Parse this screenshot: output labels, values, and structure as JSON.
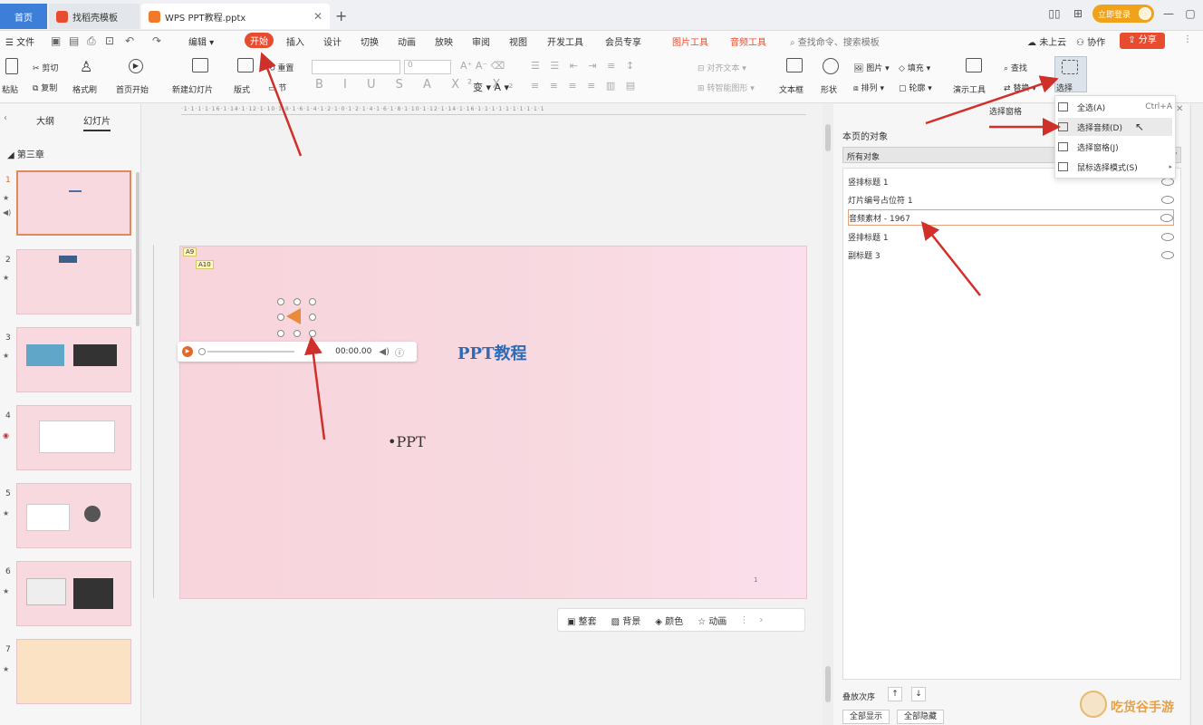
{
  "titlebar": {
    "home_tab": "首页",
    "template_tab": "找稻壳模板",
    "doc_tab": "WPS PPT教程.pptx",
    "login": "立即登录",
    "brand_color": "#3d7ed8",
    "accent": "#e84c2f"
  },
  "menu": {
    "file": "文件",
    "edit": "编辑",
    "start": "开始",
    "insert": "插入",
    "design": "设计",
    "transition": "切换",
    "animation": "动画",
    "slideshow": "放映",
    "review": "审阅",
    "view": "视图",
    "dev": "开发工具",
    "vip": "会员专享",
    "picture_tools": "图片工具",
    "audio_tools": "音频工具",
    "search": "查找命令、搜索模板",
    "cloud": "未上云",
    "collab": "协作",
    "share": "分享"
  },
  "ribbon": {
    "paste": "粘贴",
    "cut": "剪切",
    "copy": "复制",
    "format_painter": "格式刷",
    "from_start": "首页开始",
    "new_slide": "新建幻灯片",
    "layout": "版式",
    "section": "节",
    "reset": "重置",
    "font_size": "0",
    "align_text": "对齐文本",
    "smartart": "转智能图形",
    "textbox": "文本框",
    "shape": "形状",
    "picture": "图片",
    "arrange": "排列",
    "fill": "填充",
    "outline": "轮廓",
    "presentation_tool": "演示工具",
    "find": "查找",
    "replace": "替换",
    "select": "选择"
  },
  "left_panel": {
    "outline_tab": "大纲",
    "slides_tab": "幻灯片",
    "section_name": "第三章",
    "slides": [
      "1",
      "2",
      "3",
      "4",
      "5",
      "6",
      "7"
    ]
  },
  "slide": {
    "title": "PPT教程",
    "bullet": "•PPT",
    "tag1": "A9",
    "tag2": "A10",
    "audio_time": "00:00.00",
    "page_mark": "1"
  },
  "float_toolbar": {
    "theme": "整套",
    "background": "背景",
    "color": "颜色",
    "animation": "动画"
  },
  "right_panel": {
    "title": "选择窗格",
    "section": "本页的对象",
    "filter": "所有对象",
    "objects": [
      "竖排标题 1",
      "灯片编号占位符 1",
      "音频素材 - 1967",
      "竖排标题 1",
      "副标题 3"
    ],
    "order_label": "叠放次序",
    "show_all": "全部显示",
    "hide_all": "全部隐藏"
  },
  "dropdown": {
    "items": [
      {
        "label": "全选(A)",
        "shortcut": "Ctrl+A"
      },
      {
        "label": "选择音频(D)",
        "shortcut": ""
      },
      {
        "label": "选择窗格(J)",
        "shortcut": ""
      },
      {
        "label": "鼠标选择模式(S)",
        "shortcut": "▸"
      }
    ]
  },
  "watermark": "吃货谷手游"
}
